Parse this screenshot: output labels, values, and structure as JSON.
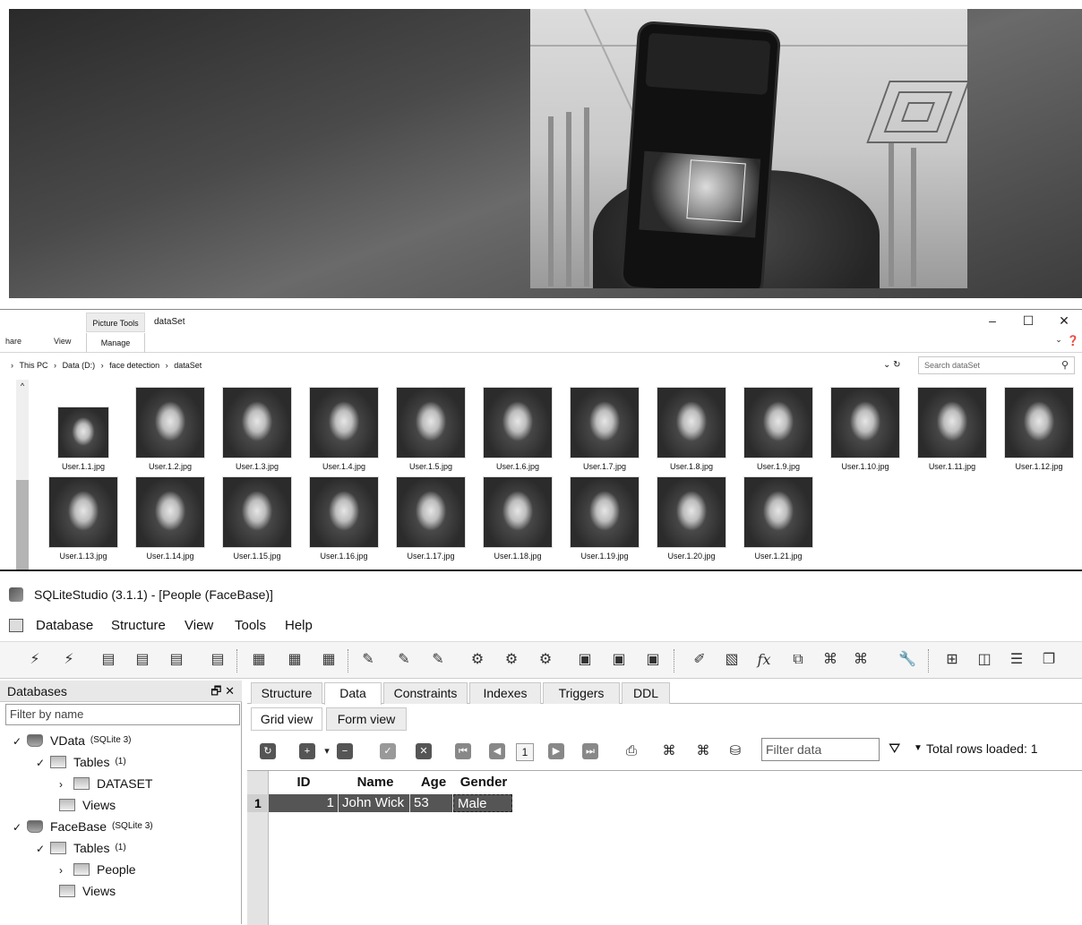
{
  "explorer": {
    "context_tab": "Picture Tools",
    "window_title": "dataSet",
    "tabs": [
      "hare",
      "View",
      "Manage"
    ],
    "breadcrumb": [
      "This PC",
      "Data (D:)",
      "face detection",
      "dataSet"
    ],
    "search_placeholder": "Search dataSet",
    "files": [
      "User.1.1.jpg",
      "User.1.2.jpg",
      "User.1.3.jpg",
      "User.1.4.jpg",
      "User.1.5.jpg",
      "User.1.6.jpg",
      "User.1.7.jpg",
      "User.1.8.jpg",
      "User.1.9.jpg",
      "User.1.10.jpg",
      "User.1.11.jpg",
      "User.1.12.jpg",
      "User.1.13.jpg",
      "User.1.14.jpg",
      "User.1.15.jpg",
      "User.1.16.jpg",
      "User.1.17.jpg",
      "User.1.18.jpg",
      "User.1.19.jpg",
      "User.1.20.jpg",
      "User.1.21.jpg"
    ]
  },
  "sqlite": {
    "title": "SQLiteStudio (3.1.1) - [People (FaceBase)]",
    "menu": [
      "Database",
      "Structure",
      "View",
      "Tools",
      "Help"
    ],
    "databases_header": "Databases",
    "filter_placeholder": "Filter by name",
    "tree": {
      "db1_name": "VData",
      "db1_type": "(SQLite 3)",
      "db1_tables": "Tables",
      "db1_tables_count": "(1)",
      "db1_table": "DATASET",
      "db1_views": "Views",
      "db2_name": "FaceBase",
      "db2_type": "(SQLite 3)",
      "db2_tables": "Tables",
      "db2_tables_count": "(1)",
      "db2_table": "People",
      "db2_views": "Views"
    },
    "tabs": [
      "Structure",
      "Data",
      "Constraints",
      "Indexes",
      "Triggers",
      "DDL"
    ],
    "subtabs": [
      "Grid view",
      "Form view"
    ],
    "page": "1",
    "filter_data_placeholder": "Filter data",
    "total_rows": "Total rows loaded: 1",
    "grid": {
      "columns": [
        "ID",
        "Name",
        "Age",
        "Gender"
      ],
      "row_number": "1",
      "row": [
        "1",
        "John Wick",
        "53",
        "Male"
      ]
    }
  }
}
